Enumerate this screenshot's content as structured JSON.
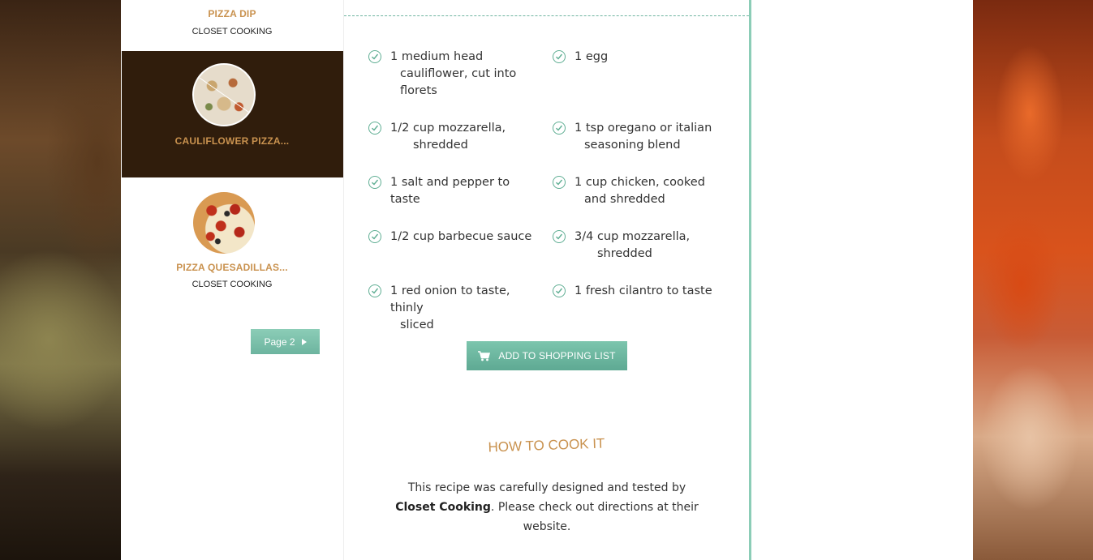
{
  "sidebar": {
    "items": [
      {
        "title": "PIZZA DIP",
        "source": "CLOSET COOKING"
      },
      {
        "title": "CAULIFLOWER PIZZA...",
        "thumb_icon": "cauliflower-pizza-thumbnail"
      },
      {
        "title": "PIZZA QUESADILLAS...",
        "source": "CLOSET COOKING",
        "thumb_icon": "pizza-quesadillas-thumbnail"
      }
    ],
    "pager_label": "Page 2"
  },
  "ingredients": [
    {
      "line1": "1 medium head",
      "line2": "cauliflower, cut into",
      "line3": "florets"
    },
    {
      "line1": "1 egg"
    },
    {
      "line1": "1/2 cup mozzarella,",
      "line2": "shredded"
    },
    {
      "line1": "1 tsp oregano or italian",
      "line2": "seasoning blend"
    },
    {
      "line1": "1 salt and pepper to taste"
    },
    {
      "line1": "1 cup chicken, cooked",
      "line2": "and shredded"
    },
    {
      "line1": "1/2 cup barbecue sauce"
    },
    {
      "line1": "3/4 cup mozzarella,",
      "line2": "shredded"
    },
    {
      "line1": "1 red onion to taste, thinly",
      "line2": "sliced"
    },
    {
      "line1": "1 fresh cilantro to taste"
    }
  ],
  "shopping_button": {
    "label": "ADD TO SHOPPING LIST",
    "icon": "cart-icon"
  },
  "how_to": {
    "title": "HOW TO COOK IT",
    "text_before": "This recipe was carefully designed and tested by",
    "source_name": "Closet Cooking",
    "text_after": ". Please check out directions at their website."
  },
  "colors": {
    "accent": "#6db49f",
    "title_orange": "#c9924f",
    "active_bg": "#301d0c"
  }
}
